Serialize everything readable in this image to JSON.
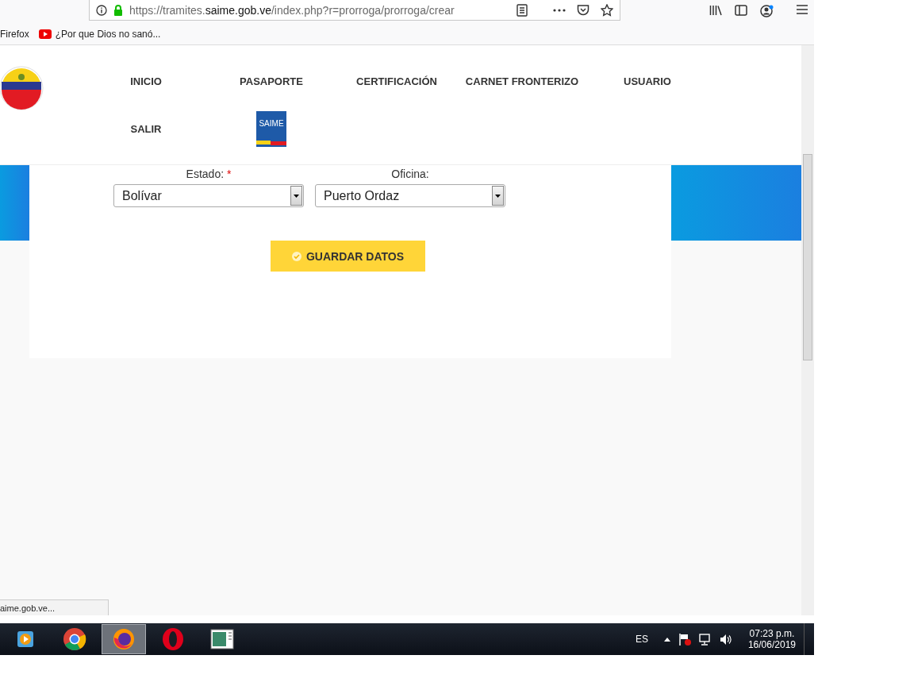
{
  "browser": {
    "url": {
      "start": "https://tramites.",
      "domain": "saime.gob.ve",
      "rest": "/index.php?r=prorroga/prorroga/crear"
    },
    "bookmarks": [
      {
        "kind": "folder",
        "label": "Firefox"
      },
      {
        "kind": "video",
        "label": "¿Por que Dios no sanó..."
      }
    ]
  },
  "nav": {
    "items": [
      {
        "kind": "link",
        "label": "INICIO"
      },
      {
        "kind": "link",
        "label": "PASAPORTE"
      },
      {
        "kind": "link",
        "label": "CERTIFICACIÓN"
      },
      {
        "kind": "link",
        "label": "CARNET FRONTERIZO"
      },
      {
        "kind": "link",
        "label": "USUARIO"
      },
      {
        "kind": "link",
        "label": "SALIR"
      },
      {
        "kind": "logo",
        "label": "SAIME"
      }
    ]
  },
  "form": {
    "fields": [
      {
        "label": "Estado:",
        "required": true,
        "value": "Bolívar"
      },
      {
        "label": "Oficina:",
        "required": false,
        "value": "Puerto Ordaz"
      }
    ],
    "required_mark": "*",
    "button": "GUARDAR DATOS"
  },
  "status_link": "aime.gob.ve...",
  "taskbar": {
    "apps": [
      {
        "kind": "media",
        "selected": false
      },
      {
        "kind": "chrome",
        "selected": false
      },
      {
        "kind": "firefox",
        "selected": true
      },
      {
        "kind": "opera",
        "selected": false
      },
      {
        "kind": "window",
        "selected": false
      }
    ],
    "language": "ES",
    "time": "07:23 p.m.",
    "date": "16/06/2019"
  }
}
